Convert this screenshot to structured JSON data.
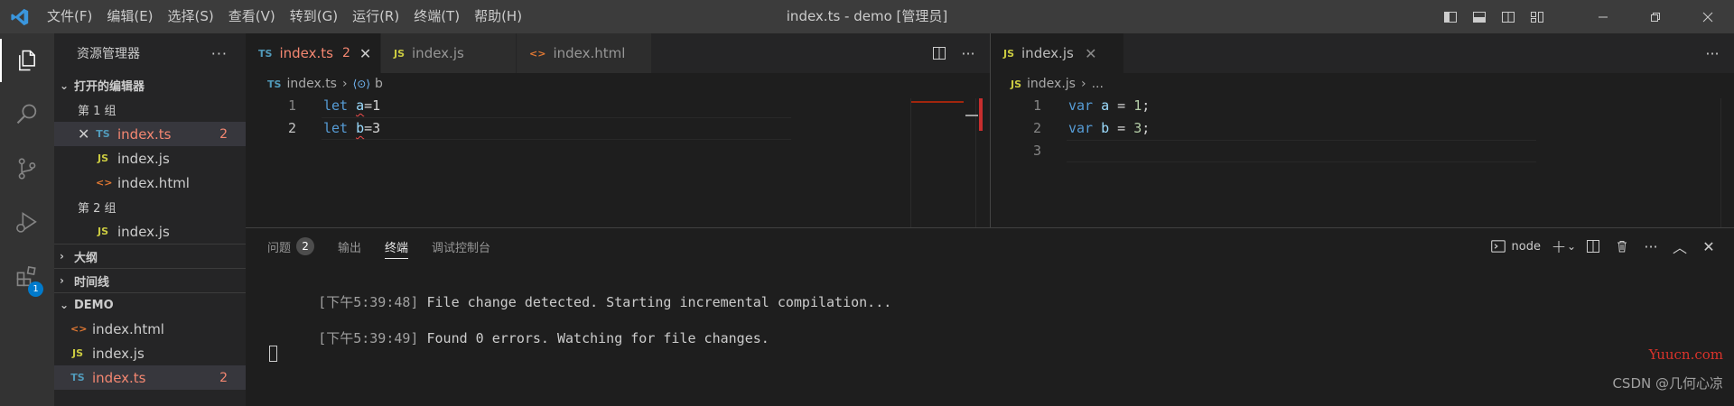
{
  "window": {
    "title": "index.ts - demo [管理员]"
  },
  "menu": [
    "文件(F)",
    "编辑(E)",
    "选择(S)",
    "查看(V)",
    "转到(G)",
    "运行(R)",
    "终端(T)",
    "帮助(H)"
  ],
  "sidebar": {
    "title": "资源管理器",
    "open_editors": {
      "label": "打开的编辑器",
      "group1_label": "第 1 组",
      "group2_label": "第 2 组",
      "group1_files": [
        {
          "icon": "TS",
          "name": "index.ts",
          "badge": "2"
        },
        {
          "icon": "JS",
          "name": "index.js"
        },
        {
          "icon": "<>",
          "name": "index.html"
        }
      ],
      "group2_files": [
        {
          "icon": "JS",
          "name": "index.js"
        }
      ]
    },
    "outline_label": "大纲",
    "timeline_label": "时间线",
    "project": {
      "label": "DEMO",
      "files": [
        {
          "icon": "<>",
          "name": "index.html"
        },
        {
          "icon": "JS",
          "name": "index.js"
        },
        {
          "icon": "TS",
          "name": "index.ts",
          "badge": "2"
        }
      ]
    }
  },
  "activity": {
    "extensions_badge": "1"
  },
  "editor1": {
    "tabs": [
      {
        "icon": "TS",
        "name": "index.ts",
        "badge": "2"
      },
      {
        "icon": "JS",
        "name": "index.js"
      },
      {
        "icon": "<>",
        "name": "index.html"
      }
    ],
    "breadcrumb": {
      "icon": "TS",
      "file": "index.ts",
      "symbol": "b"
    },
    "lines": [
      {
        "n": "1",
        "kw": "let",
        "var": "a",
        "rest": "=1"
      },
      {
        "n": "2",
        "kw": "let",
        "var": "b",
        "rest": "=3"
      }
    ]
  },
  "editor2": {
    "tab": {
      "icon": "JS",
      "name": "index.js"
    },
    "breadcrumb": {
      "icon": "JS",
      "file": "index.js",
      "rest": "..."
    },
    "lines": [
      {
        "n": "1",
        "kw": "var",
        "var": "a",
        "op": " = ",
        "num": "1",
        "end": ";"
      },
      {
        "n": "2",
        "kw": "var",
        "var": "b",
        "op": " = ",
        "num": "3",
        "end": ";"
      },
      {
        "n": "3"
      }
    ]
  },
  "panel": {
    "tabs": [
      {
        "label": "问题",
        "count": "2"
      },
      {
        "label": "输出"
      },
      {
        "label": "终端"
      },
      {
        "label": "调试控制台"
      }
    ],
    "terminal_name": "node",
    "terminal_lines": [
      {
        "time": "[下午5:39:48]",
        "text": " File change detected. Starting incremental compilation..."
      },
      {
        "time": "[下午5:39:49]",
        "text": " Found 0 errors. Watching for file changes."
      }
    ]
  },
  "watermarks": {
    "site": "Yuucn.com",
    "author": "CSDN @几何心凉"
  },
  "colors": {
    "titlebar": "#3c3c3c",
    "activitybar": "#333333",
    "sidebar": "#252526",
    "editor": "#1e1e1e",
    "accent": "#007acc",
    "error": "#f48771",
    "keyword": "#569cd6"
  }
}
